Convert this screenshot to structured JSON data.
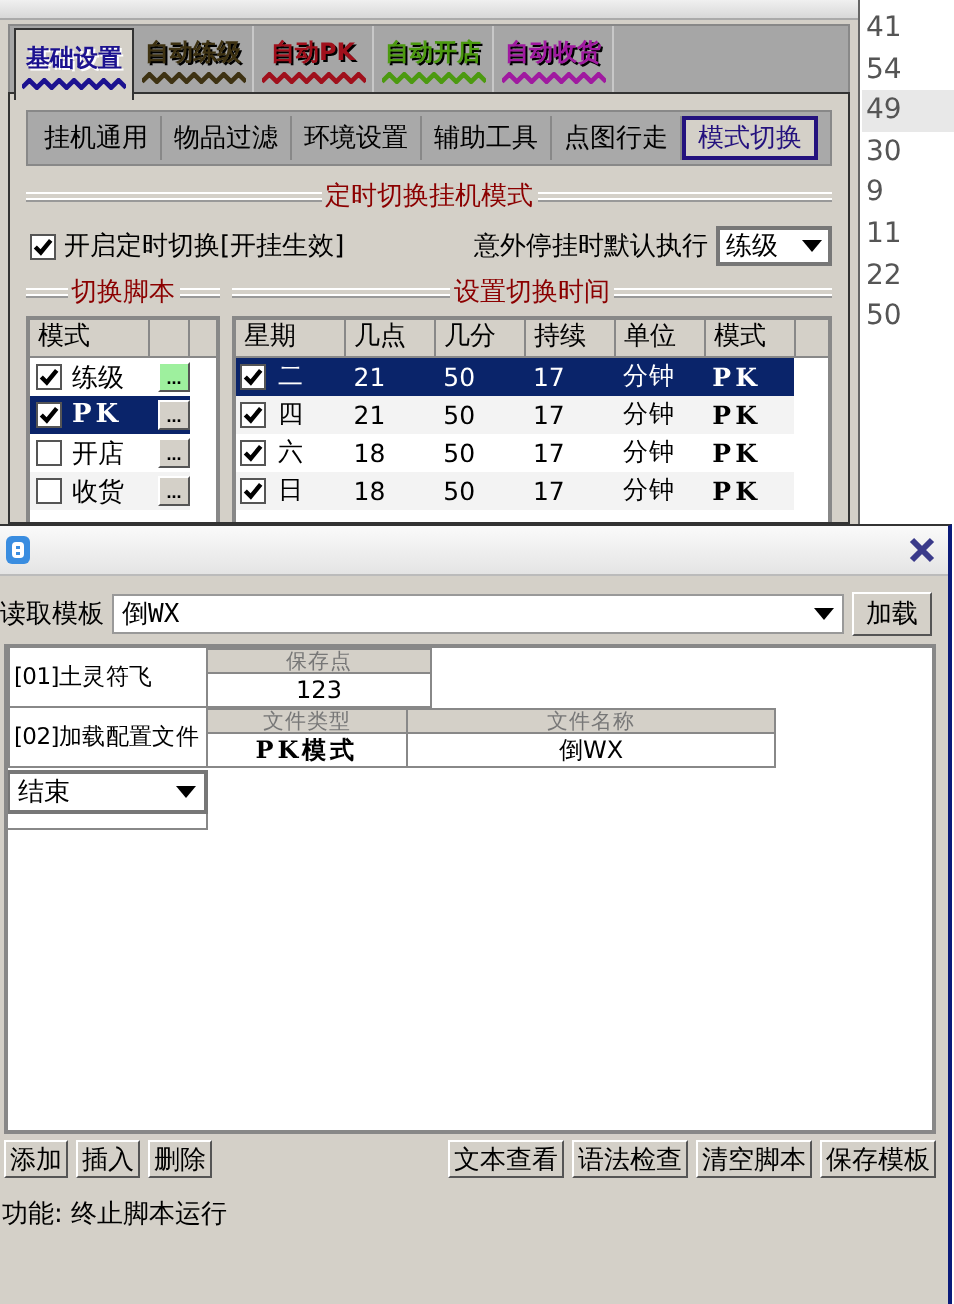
{
  "main_tabs": [
    {
      "label": "基础设置",
      "selected": true,
      "color": "#1c1290"
    },
    {
      "label": "自动练级",
      "selected": false,
      "color": "#3e3212"
    },
    {
      "label": "自动PK",
      "selected": false,
      "color": "#a0101c"
    },
    {
      "label": "自动开店",
      "selected": false,
      "color": "#4c9a10"
    },
    {
      "label": "自动收货",
      "selected": false,
      "color": "#a01aa0"
    }
  ],
  "sub_tabs": [
    {
      "label": "挂机通用",
      "selected": false
    },
    {
      "label": "物品过滤",
      "selected": false
    },
    {
      "label": "环境设置",
      "selected": false
    },
    {
      "label": "辅助工具",
      "selected": false
    },
    {
      "label": "点图行走",
      "selected": false
    },
    {
      "label": "模式切换",
      "selected": true
    }
  ],
  "schedule_title": "定时切换挂机模式",
  "enable_switch": {
    "label": "开启定时切换[开挂生效]",
    "checked": true
  },
  "fallback": {
    "label": "意外停挂时默认执行",
    "value": "练级"
  },
  "scripts_panel": {
    "title": "切换脚本",
    "column": "模式",
    "rows": [
      {
        "name": "练级",
        "checked": true,
        "selected": false,
        "edit_label": "...",
        "highlighted": true
      },
      {
        "name": "PK",
        "checked": true,
        "selected": true,
        "edit_label": "...",
        "highlighted": false
      },
      {
        "name": "开店",
        "checked": false,
        "selected": false,
        "edit_label": "...",
        "highlighted": false
      },
      {
        "name": "收货",
        "checked": false,
        "selected": false,
        "edit_label": "...",
        "highlighted": false
      }
    ]
  },
  "times_panel": {
    "title": "设置切换时间",
    "columns": [
      "星期",
      "几点",
      "几分",
      "持续",
      "单位",
      "模式"
    ],
    "rows": [
      {
        "checked": true,
        "selected": true,
        "cells": [
          "二",
          "21",
          "50",
          "17",
          "分钟",
          "PK"
        ]
      },
      {
        "checked": true,
        "selected": false,
        "cells": [
          "四",
          "21",
          "50",
          "17",
          "分钟",
          "PK"
        ]
      },
      {
        "checked": true,
        "selected": false,
        "cells": [
          "六",
          "18",
          "50",
          "17",
          "分钟",
          "PK"
        ]
      },
      {
        "checked": true,
        "selected": false,
        "cells": [
          "日",
          "18",
          "50",
          "17",
          "分钟",
          "PK"
        ]
      }
    ]
  },
  "side_list": [
    {
      "text": "41",
      "selected": false
    },
    {
      "text": "54",
      "selected": false
    },
    {
      "text": "49",
      "selected": true
    },
    {
      "text": "30",
      "selected": false
    },
    {
      "text": "9",
      "selected": false
    },
    {
      "text": "11",
      "selected": false
    },
    {
      "text": "22",
      "selected": false
    },
    {
      "text": "50",
      "selected": false
    }
  ],
  "dialog": {
    "template_label": "读取模板",
    "template_value": "倒WX",
    "load_button": "加载",
    "steps": [
      {
        "kind": "params",
        "label": "[01]土灵符飞",
        "columns": [
          "保存点"
        ],
        "values": [
          "123"
        ]
      },
      {
        "kind": "params",
        "label": "[02]加载配置文件",
        "columns": [
          "文件类型",
          "文件名称"
        ],
        "values": [
          "PK模式",
          "倒WX"
        ]
      },
      {
        "kind": "dropdown",
        "value": "结束"
      }
    ],
    "left_buttons": [
      "添加",
      "插入",
      "删除"
    ],
    "right_buttons": [
      "文本查看",
      "语法检查",
      "清空脚本",
      "保存模板"
    ],
    "function_text": "功能: 终止脚本运行"
  }
}
